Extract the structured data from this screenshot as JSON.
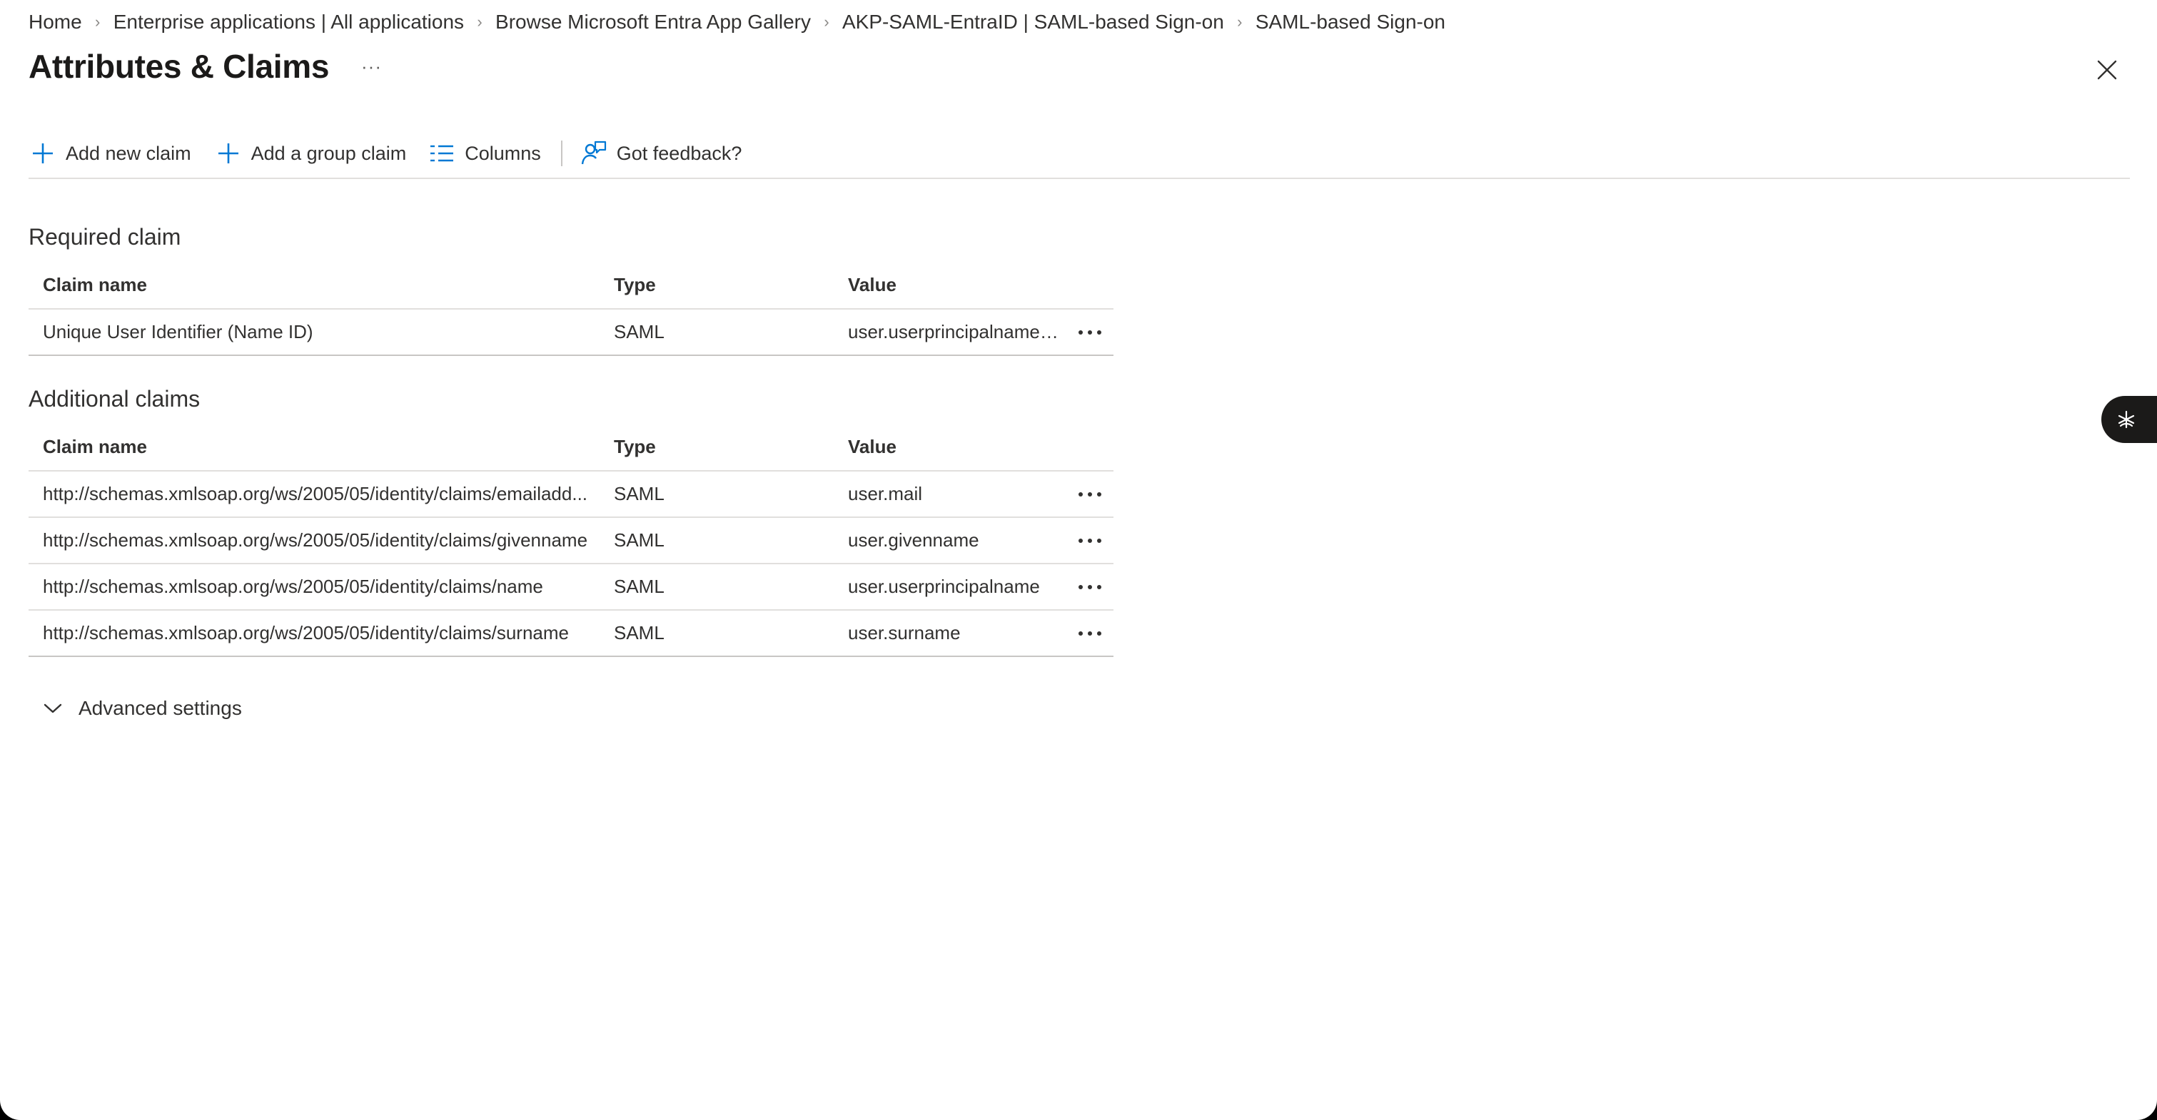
{
  "breadcrumb": {
    "items": [
      {
        "label": "Home"
      },
      {
        "label": "Enterprise applications | All applications"
      },
      {
        "label": "Browse Microsoft Entra App Gallery"
      },
      {
        "label": "AKP-SAML-EntraID | SAML-based Sign-on"
      },
      {
        "label": "SAML-based Sign-on"
      }
    ],
    "separator": "›"
  },
  "header": {
    "title": "Attributes & Claims",
    "more_label": "···",
    "close_icon": "close-icon"
  },
  "toolbar": {
    "add_claim": {
      "label": "Add new claim",
      "icon": "plus-icon"
    },
    "add_group_claim": {
      "label": "Add a group claim",
      "icon": "plus-icon"
    },
    "columns": {
      "label": "Columns",
      "icon": "columns-icon"
    },
    "feedback": {
      "label": "Got feedback?",
      "icon": "feedback-icon"
    }
  },
  "required": {
    "title": "Required claim",
    "columns": {
      "name": "Claim name",
      "type": "Type",
      "value": "Value"
    },
    "rows": [
      {
        "name": "Unique User Identifier (Name ID)",
        "type": "SAML",
        "value": "user.userprincipalname [..."
      }
    ]
  },
  "additional": {
    "title": "Additional claims",
    "columns": {
      "name": "Claim name",
      "type": "Type",
      "value": "Value"
    },
    "rows": [
      {
        "name": "http://schemas.xmlsoap.org/ws/2005/05/identity/claims/emailadd...",
        "type": "SAML",
        "value": "user.mail"
      },
      {
        "name": "http://schemas.xmlsoap.org/ws/2005/05/identity/claims/givenname",
        "type": "SAML",
        "value": "user.givenname"
      },
      {
        "name": "http://schemas.xmlsoap.org/ws/2005/05/identity/claims/name",
        "type": "SAML",
        "value": "user.userprincipalname"
      },
      {
        "name": "http://schemas.xmlsoap.org/ws/2005/05/identity/claims/surname",
        "type": "SAML",
        "value": "user.surname"
      }
    ]
  },
  "advanced": {
    "label": "Advanced settings",
    "icon": "chevron-down-icon"
  },
  "side_button": {
    "icon": "copilot-icon"
  },
  "colors": {
    "accent": "#0078d4",
    "text": "#323130",
    "divider": "#e1dfdd"
  }
}
